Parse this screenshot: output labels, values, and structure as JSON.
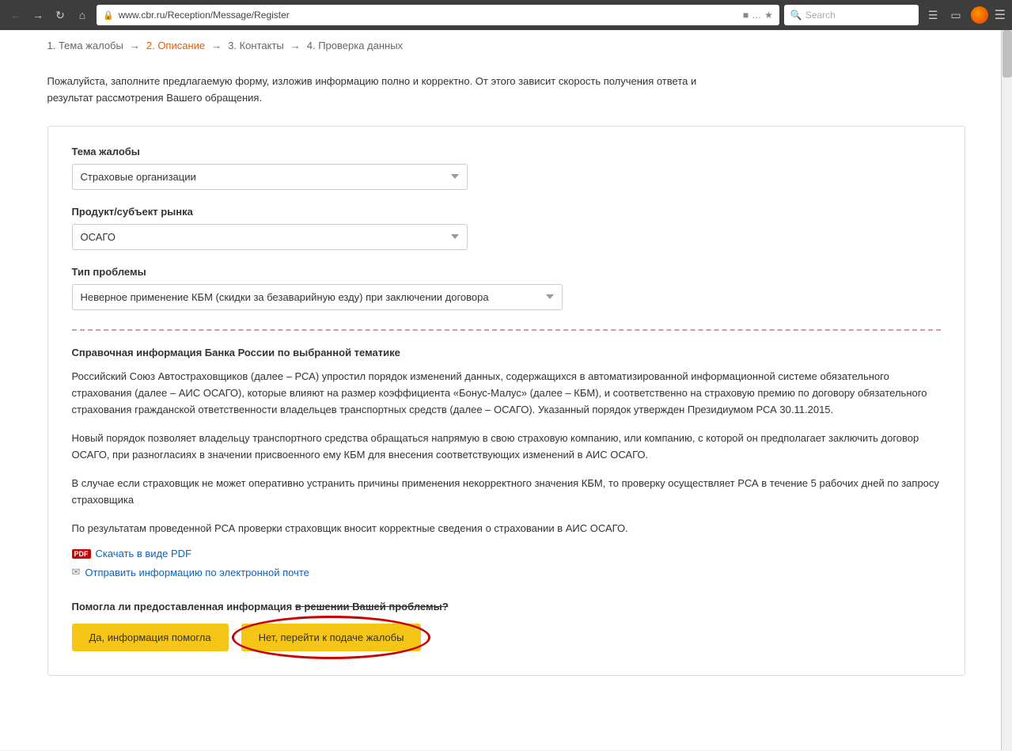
{
  "browser": {
    "back_title": "Back",
    "forward_title": "Forward",
    "reload_title": "Reload",
    "home_title": "Home",
    "url": "www.cbr.ru/Reception/Message/Register",
    "search_placeholder": "Search",
    "menu_title": "Menu"
  },
  "steps": {
    "step1": "1. Тема жалобы",
    "arrow1": "→",
    "step2": "2. Описание",
    "arrow2": "→",
    "step3": "3. Контакты",
    "arrow3": "→",
    "step4": "4. Проверка данных"
  },
  "intro": "Пожалуйста, заполните предлагаемую форму, изложив информацию полно и корректно. От этого зависит скорость получения ответа и результат рассмотрения Вашего обращения.",
  "form": {
    "label_tema": "Тема жалобы",
    "value_tema": "Страховые организации",
    "label_produkt": "Продукт/субъект рынка",
    "value_produkt": "ОСАГО",
    "label_tip": "Тип проблемы",
    "value_tip": "Неверное применение КБМ (скидки за безаварийную езду) при заключении договора"
  },
  "info": {
    "title": "Справочная информация Банка России по выбранной тематике",
    "para1": "Российский Союз Автостраховщиков (далее – РСА) упростил порядок изменений данных, содержащихся в автоматизированной информационной системе обязательного страхования (далее – АИС ОСАГО), которые влияют на размер коэффициента «Бонус-Малус» (далее – КБМ), и соответственно на страховую премию по договору обязательного страхования гражданской ответственности владельцев транспортных средств (далее – ОСАГО). Указанный порядок утвержден Президиумом РСА 30.11.2015.",
    "para2": "Новый порядок позволяет владельцу транспортного средства обращаться напрямую в свою страховую компанию, или компанию, с которой он предполагает заключить договор ОСАГО, при разногласиях в значении присвоенного ему КБМ для внесения соответствующих изменений в АИС ОСАГО.",
    "para3": "В случае если страховщик не может оперативно устранить причины применения некорректного значения КБМ, то проверку осуществляет РСА в течение 5 рабочих дней по запросу страховщика",
    "para4": "По результатам проведенной РСА проверки страховщик вносит корректные сведения о страховании в АИС ОСАГО.",
    "pdf_label": "Скачать в виде PDF",
    "email_label": "Отправить информацию по электронной почте"
  },
  "question": {
    "text": "Помогла ли предоставленная информация в решении Вашей проблемы?",
    "btn_yes": "Да, информация помогла",
    "btn_no": "Нет, перейти к подаче жалобы"
  }
}
